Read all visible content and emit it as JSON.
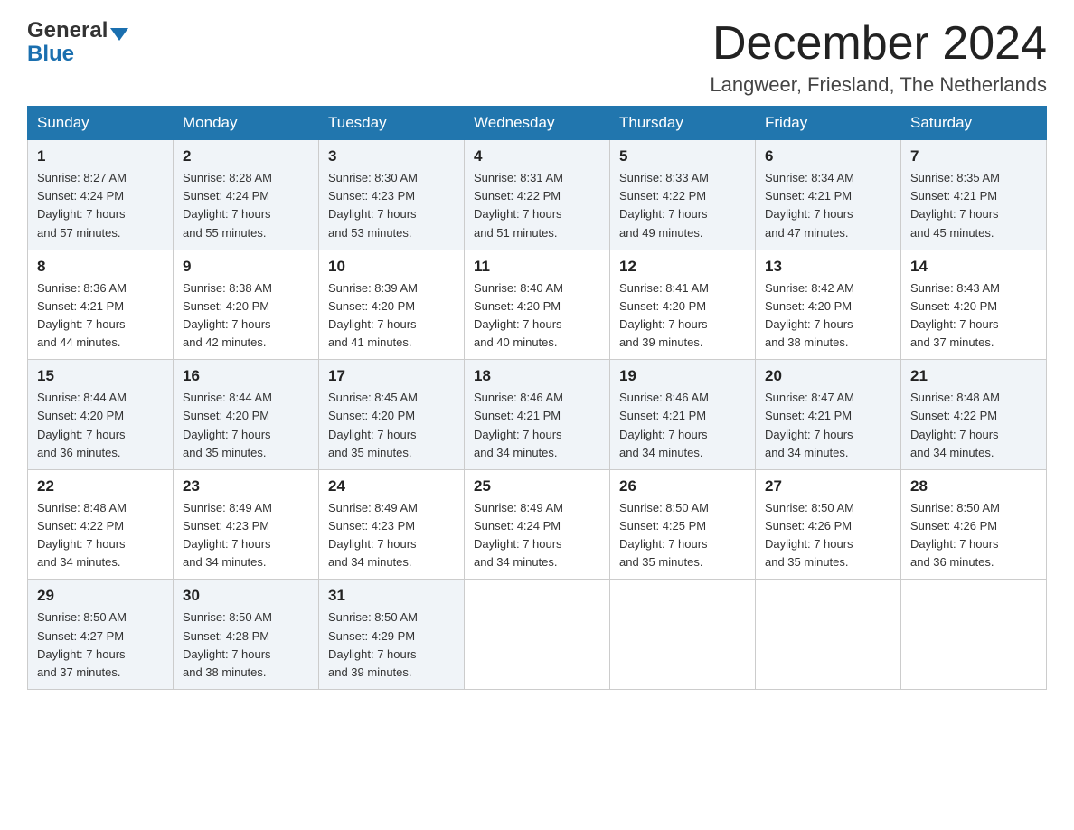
{
  "header": {
    "logo_general": "General",
    "logo_blue": "Blue",
    "month_title": "December 2024",
    "location": "Langweer, Friesland, The Netherlands"
  },
  "days_of_week": [
    "Sunday",
    "Monday",
    "Tuesday",
    "Wednesday",
    "Thursday",
    "Friday",
    "Saturday"
  ],
  "weeks": [
    [
      {
        "day": "1",
        "sunrise": "8:27 AM",
        "sunset": "4:24 PM",
        "daylight": "7 hours and 57 minutes."
      },
      {
        "day": "2",
        "sunrise": "8:28 AM",
        "sunset": "4:24 PM",
        "daylight": "7 hours and 55 minutes."
      },
      {
        "day": "3",
        "sunrise": "8:30 AM",
        "sunset": "4:23 PM",
        "daylight": "7 hours and 53 minutes."
      },
      {
        "day": "4",
        "sunrise": "8:31 AM",
        "sunset": "4:22 PM",
        "daylight": "7 hours and 51 minutes."
      },
      {
        "day": "5",
        "sunrise": "8:33 AM",
        "sunset": "4:22 PM",
        "daylight": "7 hours and 49 minutes."
      },
      {
        "day": "6",
        "sunrise": "8:34 AM",
        "sunset": "4:21 PM",
        "daylight": "7 hours and 47 minutes."
      },
      {
        "day": "7",
        "sunrise": "8:35 AM",
        "sunset": "4:21 PM",
        "daylight": "7 hours and 45 minutes."
      }
    ],
    [
      {
        "day": "8",
        "sunrise": "8:36 AM",
        "sunset": "4:21 PM",
        "daylight": "7 hours and 44 minutes."
      },
      {
        "day": "9",
        "sunrise": "8:38 AM",
        "sunset": "4:20 PM",
        "daylight": "7 hours and 42 minutes."
      },
      {
        "day": "10",
        "sunrise": "8:39 AM",
        "sunset": "4:20 PM",
        "daylight": "7 hours and 41 minutes."
      },
      {
        "day": "11",
        "sunrise": "8:40 AM",
        "sunset": "4:20 PM",
        "daylight": "7 hours and 40 minutes."
      },
      {
        "day": "12",
        "sunrise": "8:41 AM",
        "sunset": "4:20 PM",
        "daylight": "7 hours and 39 minutes."
      },
      {
        "day": "13",
        "sunrise": "8:42 AM",
        "sunset": "4:20 PM",
        "daylight": "7 hours and 38 minutes."
      },
      {
        "day": "14",
        "sunrise": "8:43 AM",
        "sunset": "4:20 PM",
        "daylight": "7 hours and 37 minutes."
      }
    ],
    [
      {
        "day": "15",
        "sunrise": "8:44 AM",
        "sunset": "4:20 PM",
        "daylight": "7 hours and 36 minutes."
      },
      {
        "day": "16",
        "sunrise": "8:44 AM",
        "sunset": "4:20 PM",
        "daylight": "7 hours and 35 minutes."
      },
      {
        "day": "17",
        "sunrise": "8:45 AM",
        "sunset": "4:20 PM",
        "daylight": "7 hours and 35 minutes."
      },
      {
        "day": "18",
        "sunrise": "8:46 AM",
        "sunset": "4:21 PM",
        "daylight": "7 hours and 34 minutes."
      },
      {
        "day": "19",
        "sunrise": "8:46 AM",
        "sunset": "4:21 PM",
        "daylight": "7 hours and 34 minutes."
      },
      {
        "day": "20",
        "sunrise": "8:47 AM",
        "sunset": "4:21 PM",
        "daylight": "7 hours and 34 minutes."
      },
      {
        "day": "21",
        "sunrise": "8:48 AM",
        "sunset": "4:22 PM",
        "daylight": "7 hours and 34 minutes."
      }
    ],
    [
      {
        "day": "22",
        "sunrise": "8:48 AM",
        "sunset": "4:22 PM",
        "daylight": "7 hours and 34 minutes."
      },
      {
        "day": "23",
        "sunrise": "8:49 AM",
        "sunset": "4:23 PM",
        "daylight": "7 hours and 34 minutes."
      },
      {
        "day": "24",
        "sunrise": "8:49 AM",
        "sunset": "4:23 PM",
        "daylight": "7 hours and 34 minutes."
      },
      {
        "day": "25",
        "sunrise": "8:49 AM",
        "sunset": "4:24 PM",
        "daylight": "7 hours and 34 minutes."
      },
      {
        "day": "26",
        "sunrise": "8:50 AM",
        "sunset": "4:25 PM",
        "daylight": "7 hours and 35 minutes."
      },
      {
        "day": "27",
        "sunrise": "8:50 AM",
        "sunset": "4:26 PM",
        "daylight": "7 hours and 35 minutes."
      },
      {
        "day": "28",
        "sunrise": "8:50 AM",
        "sunset": "4:26 PM",
        "daylight": "7 hours and 36 minutes."
      }
    ],
    [
      {
        "day": "29",
        "sunrise": "8:50 AM",
        "sunset": "4:27 PM",
        "daylight": "7 hours and 37 minutes."
      },
      {
        "day": "30",
        "sunrise": "8:50 AM",
        "sunset": "4:28 PM",
        "daylight": "7 hours and 38 minutes."
      },
      {
        "day": "31",
        "sunrise": "8:50 AM",
        "sunset": "4:29 PM",
        "daylight": "7 hours and 39 minutes."
      },
      null,
      null,
      null,
      null
    ]
  ],
  "labels": {
    "sunrise": "Sunrise:",
    "sunset": "Sunset:",
    "daylight": "Daylight:"
  }
}
